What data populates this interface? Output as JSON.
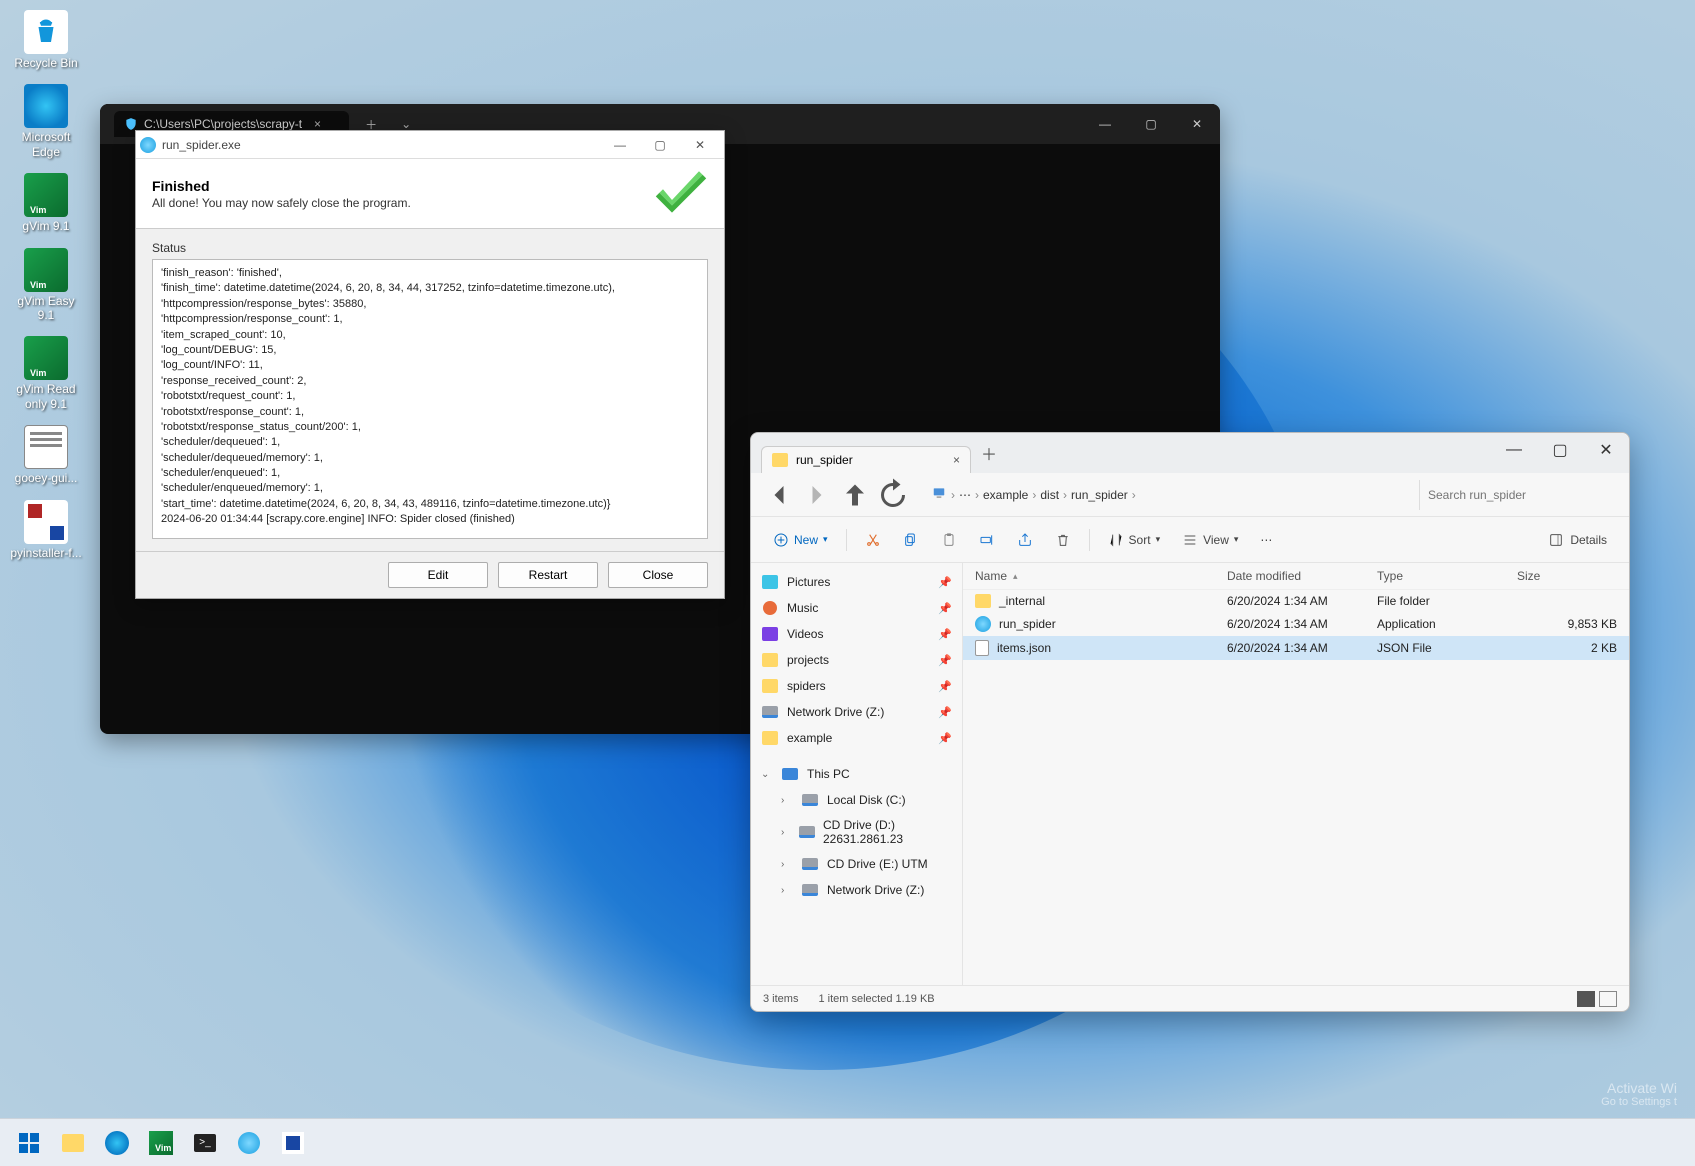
{
  "desktop": {
    "icons": [
      {
        "label": "Recycle Bin",
        "kind": "bin"
      },
      {
        "label": "Microsoft Edge",
        "kind": "edge"
      },
      {
        "label": "gVim 9.1",
        "kind": "vim"
      },
      {
        "label": "gVim Easy 9.1",
        "kind": "vim"
      },
      {
        "label": "gVim Read only 9.1",
        "kind": "vim"
      },
      {
        "label": "gooey-gui...",
        "kind": "txt"
      },
      {
        "label": "pyinstaller-f...",
        "kind": "pyi"
      }
    ]
  },
  "terminal": {
    "tab_title": "C:\\Users\\PC\\projects\\scrapy-t"
  },
  "dialog": {
    "title": "run_spider.exe",
    "header_title": "Finished",
    "header_sub": "All done! You may now safely close the program.",
    "status_label": "Status",
    "status_lines": [
      "'finish_reason': 'finished',",
      "'finish_time': datetime.datetime(2024, 6, 20, 8, 34, 44, 317252, tzinfo=datetime.timezone.utc),",
      "'httpcompression/response_bytes': 35880,",
      "'httpcompression/response_count': 1,",
      "'item_scraped_count': 10,",
      "'log_count/DEBUG': 15,",
      "'log_count/INFO': 11,",
      "'response_received_count': 2,",
      "'robotstxt/request_count': 1,",
      "'robotstxt/response_count': 1,",
      "'robotstxt/response_status_count/200': 1,",
      "'scheduler/dequeued': 1,",
      "'scheduler/dequeued/memory': 1,",
      "'scheduler/enqueued': 1,",
      "'scheduler/enqueued/memory': 1,",
      "'start_time': datetime.datetime(2024, 6, 20, 8, 34, 43, 489116, tzinfo=datetime.timezone.utc)}",
      "2024-06-20 01:34:44 [scrapy.core.engine] INFO: Spider closed (finished)"
    ],
    "buttons": {
      "edit": "Edit",
      "restart": "Restart",
      "close": "Close"
    }
  },
  "explorer": {
    "tab_title": "run_spider",
    "breadcrumbs": [
      "example",
      "dist",
      "run_spider"
    ],
    "search_placeholder": "Search run_spider",
    "toolbar": {
      "new": "New",
      "sort": "Sort",
      "view": "View",
      "details": "Details"
    },
    "columns": {
      "name": "Name",
      "date": "Date modified",
      "type": "Type",
      "size": "Size"
    },
    "sidebar": {
      "quick": [
        {
          "label": "Pictures",
          "ico": "pic"
        },
        {
          "label": "Music",
          "ico": "mus"
        },
        {
          "label": "Videos",
          "ico": "vid"
        },
        {
          "label": "projects",
          "ico": "fold"
        },
        {
          "label": "spiders",
          "ico": "fold"
        },
        {
          "label": "Network Drive (Z:)",
          "ico": "drive"
        },
        {
          "label": "example",
          "ico": "fold"
        }
      ],
      "thispc": "This PC",
      "drives": [
        {
          "label": "Local Disk (C:)"
        },
        {
          "label": "CD Drive (D:) 22631.2861.23"
        },
        {
          "label": "CD Drive (E:) UTM"
        },
        {
          "label": "Network Drive (Z:)"
        }
      ]
    },
    "files": [
      {
        "name": "_internal",
        "date": "6/20/2024 1:34 AM",
        "type": "File folder",
        "size": "",
        "ico": "fold",
        "selected": false
      },
      {
        "name": "run_spider",
        "date": "6/20/2024 1:34 AM",
        "type": "Application",
        "size": "9,853 KB",
        "ico": "app",
        "selected": false
      },
      {
        "name": "items.json",
        "date": "6/20/2024 1:34 AM",
        "type": "JSON File",
        "size": "2 KB",
        "ico": "file",
        "selected": true
      }
    ],
    "status": {
      "count": "3 items",
      "selected": "1 item selected  1.19 KB"
    }
  },
  "watermark": {
    "l1": "Activate Wi",
    "l2": "Go to Settings t"
  }
}
